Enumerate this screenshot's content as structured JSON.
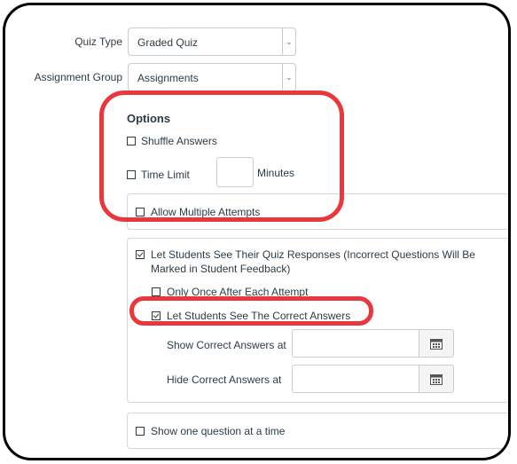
{
  "quiz_type": {
    "label": "Quiz Type",
    "value": "Graded Quiz"
  },
  "assignment_group": {
    "label": "Assignment Group",
    "value": "Assignments"
  },
  "options": {
    "heading": "Options",
    "shuffle_answers": "Shuffle Answers",
    "time_limit": "Time Limit",
    "minutes": "Minutes",
    "allow_multiple_attempts": "Allow Multiple Attempts"
  },
  "responses": {
    "let_students_see_line1": "Let Students See Their Quiz Responses (Incorrect Questions Will Be",
    "let_students_see_line2": "Marked in Student Feedback)",
    "only_once": "Only Once After Each Attempt",
    "see_correct_answers": "Let Students See The Correct Answers",
    "show_correct_label": "Show Correct Answers at",
    "hide_correct_label": "Hide Correct Answers at"
  },
  "one_question": "Show one question at a time",
  "colors": {
    "highlight": "#e8383d",
    "text": "#2d3b45",
    "border": "#c7cdd1"
  }
}
